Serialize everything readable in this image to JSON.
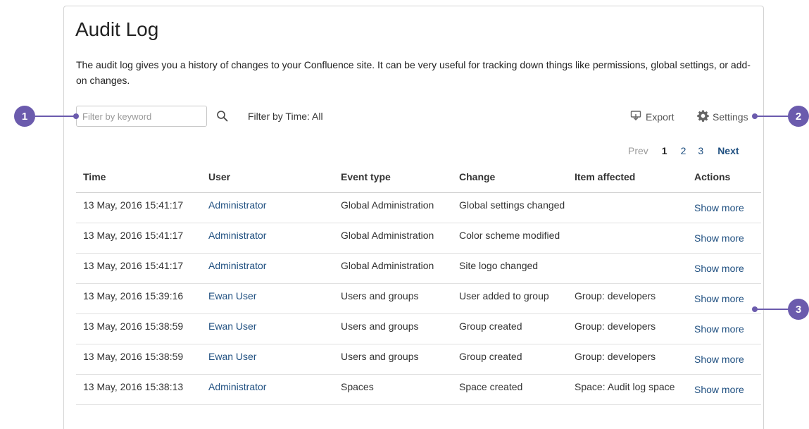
{
  "page": {
    "title": "Audit Log",
    "description": "The audit log gives you a history of changes to your Confluence site. It can be very useful for tracking down things like permissions, global settings, or add-on changes."
  },
  "toolbar": {
    "filter_placeholder": "Filter by keyword",
    "filter_value": "",
    "time_filter": "Filter by Time: All",
    "export_label": "Export",
    "settings_label": "Settings"
  },
  "pagination": {
    "prev": "Prev",
    "pages": [
      "1",
      "2",
      "3"
    ],
    "current": "1",
    "next": "Next"
  },
  "table": {
    "headers": [
      "Time",
      "User",
      "Event type",
      "Change",
      "Item affected",
      "Actions"
    ],
    "rows": [
      {
        "time": "13 May, 2016 15:41:17",
        "user": "Administrator",
        "event": "Global Administration",
        "change": "Global settings changed",
        "item": "",
        "action": "Show more"
      },
      {
        "time": "13 May, 2016 15:41:17",
        "user": "Administrator",
        "event": "Global Administration",
        "change": "Color scheme modified",
        "item": "",
        "action": "Show more"
      },
      {
        "time": "13 May, 2016 15:41:17",
        "user": "Administrator",
        "event": "Global Administration",
        "change": "Site logo changed",
        "item": "",
        "action": "Show more"
      },
      {
        "time": "13 May, 2016 15:39:16",
        "user": "Ewan User",
        "event": "Users and groups",
        "change": "User added to group",
        "item": "Group: developers",
        "action": "Show more"
      },
      {
        "time": "13 May, 2016 15:38:59",
        "user": "Ewan User",
        "event": "Users and groups",
        "change": "Group created",
        "item": "Group: developers",
        "action": "Show more"
      },
      {
        "time": "13 May, 2016 15:38:59",
        "user": "Ewan User",
        "event": "Users and groups",
        "change": "Group created",
        "item": "Group: developers",
        "action": "Show more"
      },
      {
        "time": "13 May, 2016 15:38:13",
        "user": "Administrator",
        "event": "Spaces",
        "change": "Space created",
        "item": "Space: Audit log space",
        "action": "Show more"
      }
    ]
  },
  "callouts": [
    "1",
    "2",
    "3"
  ],
  "colors": {
    "link": "#205081",
    "callout": "#6b5bad"
  },
  "icons": {
    "search": "search-icon",
    "export": "export-icon",
    "settings": "gear-icon"
  }
}
